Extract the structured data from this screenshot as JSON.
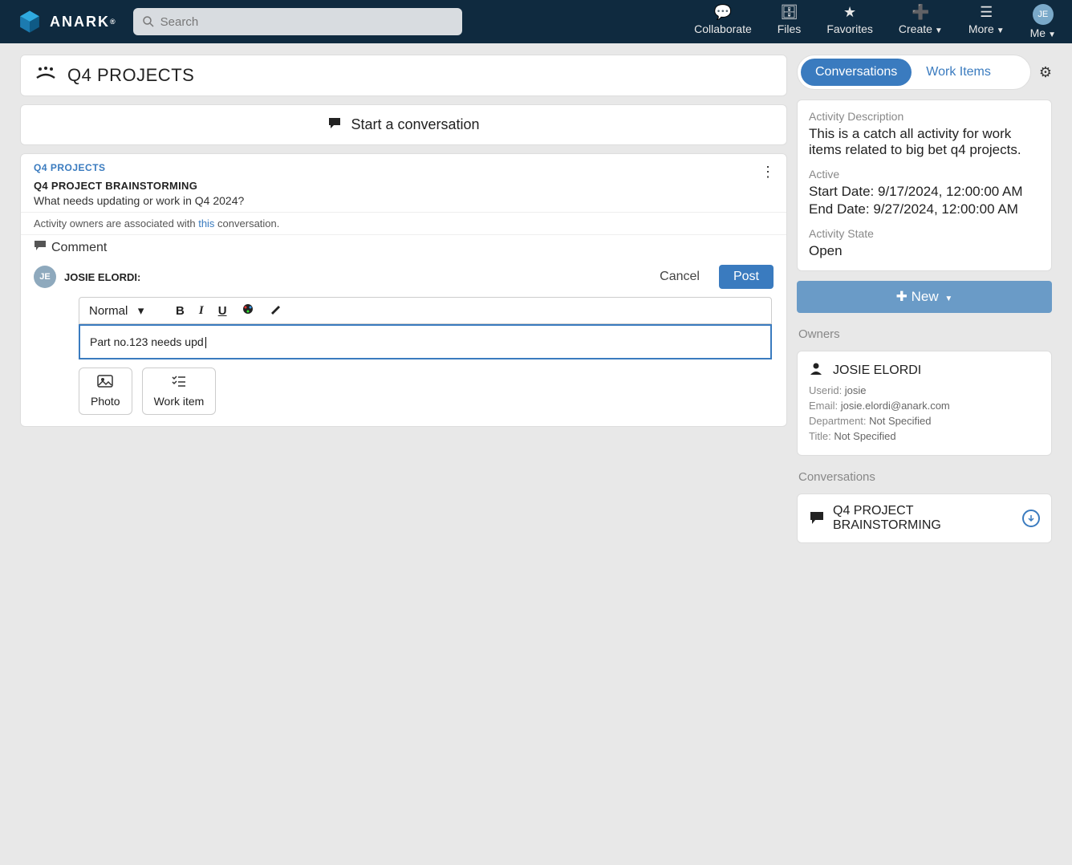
{
  "brand": "ANARK",
  "search": {
    "placeholder": "Search"
  },
  "nav": {
    "collaborate": "Collaborate",
    "files": "Files",
    "favorites": "Favorites",
    "create": "Create",
    "more": "More",
    "me": "Me",
    "initials": "JE"
  },
  "page_title": "Q4 PROJECTS",
  "start_convo": "Start a conversation",
  "conversation": {
    "breadcrumb": "Q4 PROJECTS",
    "title": "Q4 PROJECT BRAINSTORMING",
    "body": "What needs updating or work in Q4 2024?",
    "owners_note_pre": "Activity owners are associated with ",
    "owners_note_link": "this",
    "owners_note_post": " conversation."
  },
  "comment": {
    "header": "Comment",
    "user_initials": "JE",
    "user": "JOSIE ELORDI:",
    "cancel": "Cancel",
    "post": "Post",
    "format_select": "Normal",
    "input_value": "Part no.123 needs upd",
    "attach_photo": "Photo",
    "attach_workitem": "Work item"
  },
  "side_tabs": {
    "conversations": "Conversations",
    "work_items": "Work Items"
  },
  "activity": {
    "desc_label": "Activity Description",
    "desc": "This is a catch all activity for work items related to big bet q4 projects.",
    "active_label": "Active",
    "start_label": "Start Date: ",
    "start_value": "9/17/2024, 12:00:00 AM",
    "end_label": "End Date: ",
    "end_value": "9/27/2024, 12:00:00 AM",
    "state_label": "Activity State",
    "state_value": "Open"
  },
  "new_button": "New",
  "owners_label": "Owners",
  "owner": {
    "name": "JOSIE ELORDI",
    "userid_label": "Userid: ",
    "userid": "josie",
    "email_label": "Email: ",
    "email": "josie.elordi@anark.com",
    "dept_label": "Department: ",
    "dept": "Not Specified",
    "title_label": "Title: ",
    "title": "Not Specified"
  },
  "conversations_label": "Conversations",
  "convo_list_item": "Q4 PROJECT BRAINSTORMING"
}
